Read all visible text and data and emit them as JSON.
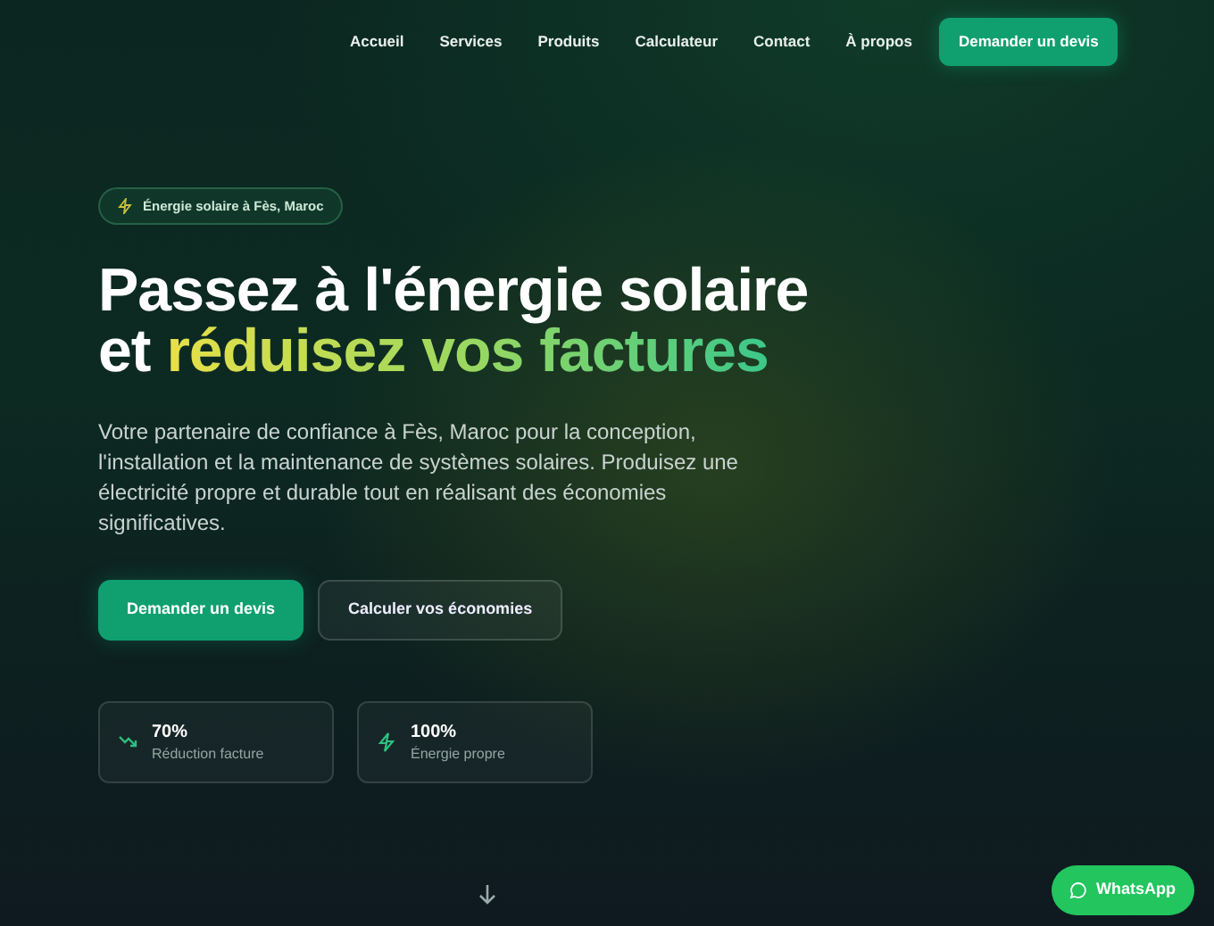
{
  "nav": {
    "links": [
      "Accueil",
      "Services",
      "Produits",
      "Calculateur",
      "Contact",
      "À propos"
    ],
    "cta": "Demander un devis"
  },
  "hero": {
    "badge": "Énergie solaire à Fès, Maroc",
    "headline": {
      "lead": "Passez à l'énergie solaire",
      "connector": "et",
      "highlight": "réduisez vos factures"
    },
    "description": "Votre partenaire de confiance à Fès, Maroc pour la conception, l'installation et la maintenance de systèmes solaires. Produisez une électricité propre et durable tout en réalisant des économies significatives.",
    "buttons": [
      {
        "label": "Demander un devis",
        "kind": "primary"
      },
      {
        "label": "Calculer vos économies",
        "kind": "secondary"
      }
    ],
    "stats": [
      {
        "value": "70%",
        "label": "Réduction facture",
        "kind": "trend"
      },
      {
        "value": "100%",
        "label": "Énergie propre",
        "kind": "zap"
      }
    ]
  },
  "whatsapp": "WhatsApp"
}
